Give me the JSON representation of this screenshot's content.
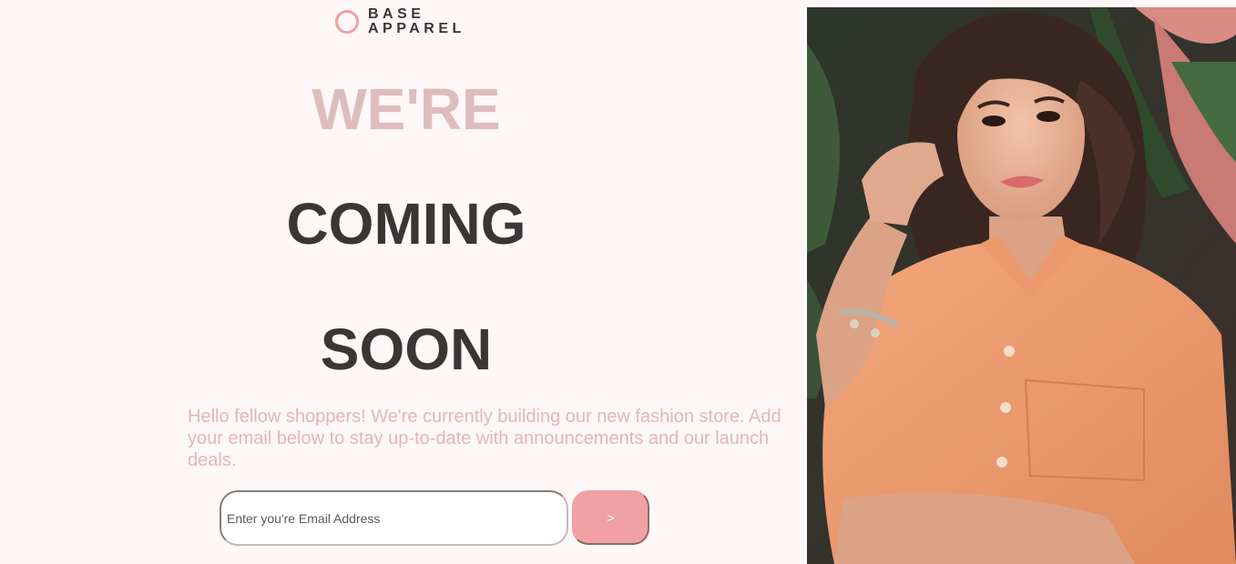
{
  "brand": {
    "line1": "BASE",
    "line2": "APPAREL",
    "accent_color": "#f0a0a4"
  },
  "headline": {
    "word1": "WE'RE",
    "word2": "COMING",
    "word3": "SOON"
  },
  "intro_text": "Hello fellow shoppers! We're currently building our new fashion store. Add your email below to stay up-to-date with announcements and our launch deals.",
  "form": {
    "email_placeholder": "Enter you're Email Address",
    "email_value": "",
    "submit_label": ">"
  },
  "colors": {
    "background": "#fef7f7",
    "heading_dark": "#3b3636",
    "heading_light": "#dfbcbc",
    "body_text": "#e3b6b6",
    "button": "#f1a1a3"
  },
  "hero": {
    "icon": "photo-icon"
  }
}
